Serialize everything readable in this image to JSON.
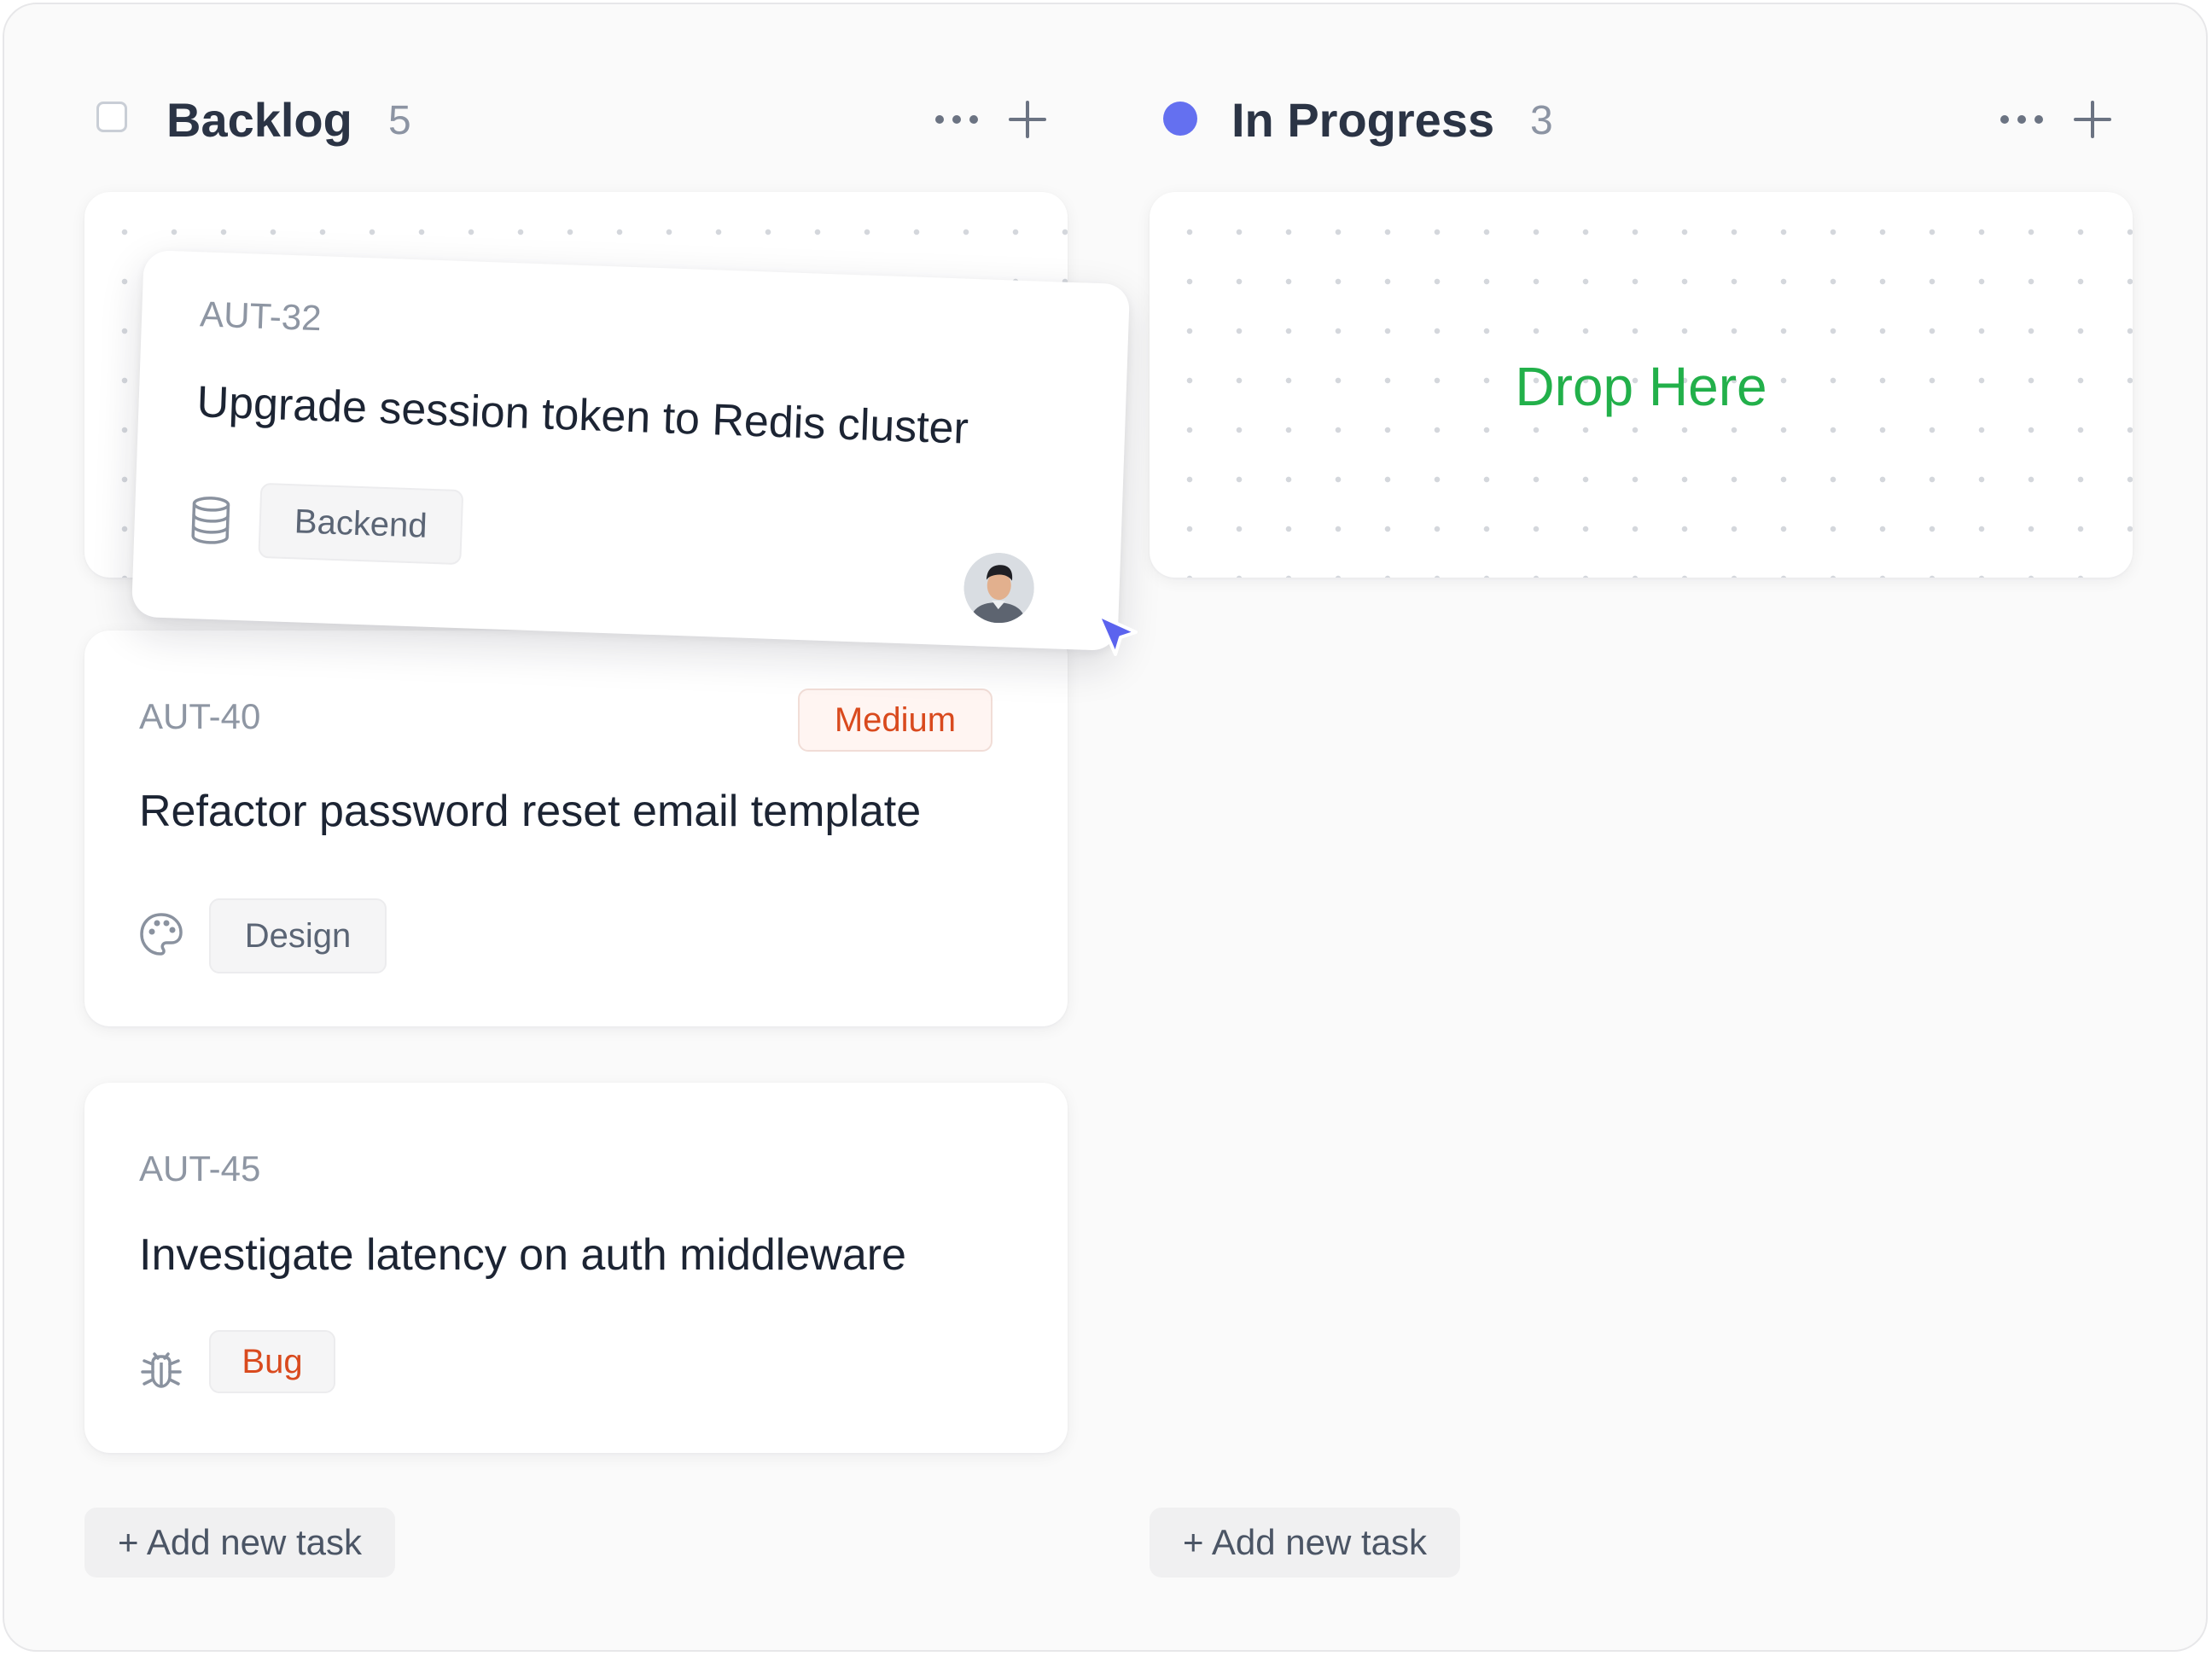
{
  "columns": [
    {
      "title": "Backlog",
      "count": "5",
      "add_task_label": "+ Add new task",
      "status_icon": "checkbox-empty-icon"
    },
    {
      "title": "In Progress",
      "count": "3",
      "add_task_label": "+ Add new task",
      "status_icon": "status-dot-icon",
      "status_color": "#6470f0"
    }
  ],
  "dragging_card": {
    "id": "AUT-32",
    "title": "Upgrade session token to Redis cluster",
    "tag": "Backend",
    "tag_icon": "database-icon",
    "has_avatar": true
  },
  "backlog_cards": [
    {
      "id": "AUT-40",
      "priority": "Medium",
      "title": "Refactor password reset email template",
      "tag": "Design",
      "tag_icon": "palette-icon"
    },
    {
      "id": "AUT-45",
      "title": "Investigate latency on auth middleware",
      "tag": "Bug",
      "tag_icon": "bug-icon"
    }
  ],
  "drop_zone": {
    "label": "Drop Here"
  },
  "colors": {
    "accent": "#6470f0",
    "drop_text": "#22b04a",
    "warning_text": "#d94a1e",
    "cursor": "#5b63ee"
  }
}
